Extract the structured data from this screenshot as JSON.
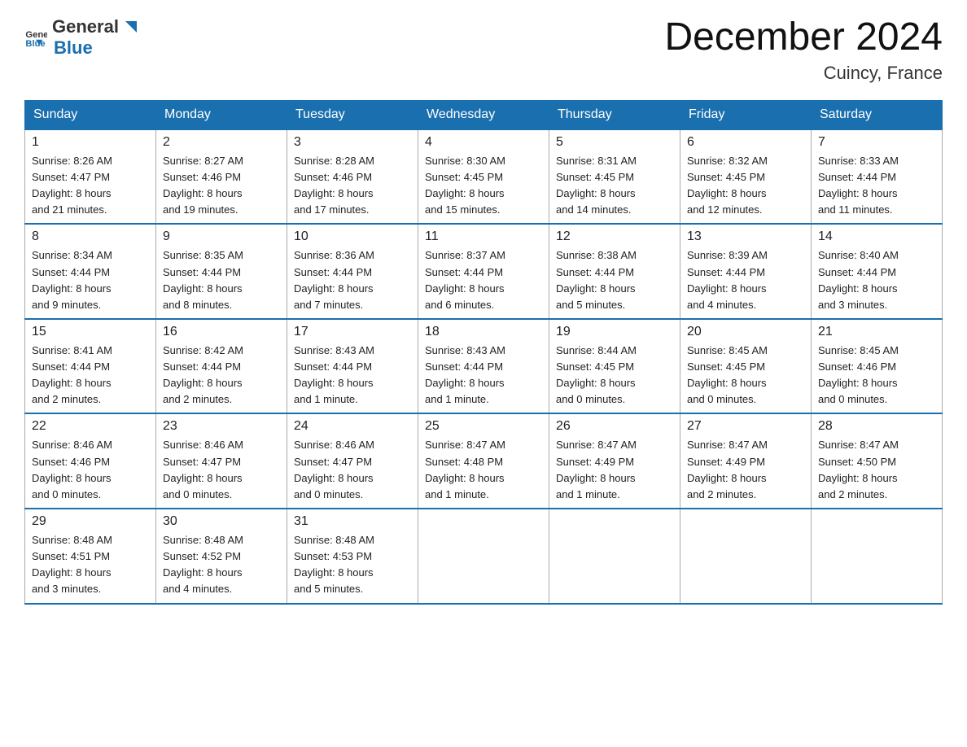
{
  "logo": {
    "general": "General",
    "blue": "Blue"
  },
  "title": "December 2024",
  "location": "Cuincy, France",
  "days_of_week": [
    "Sunday",
    "Monday",
    "Tuesday",
    "Wednesday",
    "Thursday",
    "Friday",
    "Saturday"
  ],
  "weeks": [
    [
      {
        "day": "1",
        "sunrise": "8:26 AM",
        "sunset": "4:47 PM",
        "daylight": "8 hours and 21 minutes."
      },
      {
        "day": "2",
        "sunrise": "8:27 AM",
        "sunset": "4:46 PM",
        "daylight": "8 hours and 19 minutes."
      },
      {
        "day": "3",
        "sunrise": "8:28 AM",
        "sunset": "4:46 PM",
        "daylight": "8 hours and 17 minutes."
      },
      {
        "day": "4",
        "sunrise": "8:30 AM",
        "sunset": "4:45 PM",
        "daylight": "8 hours and 15 minutes."
      },
      {
        "day": "5",
        "sunrise": "8:31 AM",
        "sunset": "4:45 PM",
        "daylight": "8 hours and 14 minutes."
      },
      {
        "day": "6",
        "sunrise": "8:32 AM",
        "sunset": "4:45 PM",
        "daylight": "8 hours and 12 minutes."
      },
      {
        "day": "7",
        "sunrise": "8:33 AM",
        "sunset": "4:44 PM",
        "daylight": "8 hours and 11 minutes."
      }
    ],
    [
      {
        "day": "8",
        "sunrise": "8:34 AM",
        "sunset": "4:44 PM",
        "daylight": "8 hours and 9 minutes."
      },
      {
        "day": "9",
        "sunrise": "8:35 AM",
        "sunset": "4:44 PM",
        "daylight": "8 hours and 8 minutes."
      },
      {
        "day": "10",
        "sunrise": "8:36 AM",
        "sunset": "4:44 PM",
        "daylight": "8 hours and 7 minutes."
      },
      {
        "day": "11",
        "sunrise": "8:37 AM",
        "sunset": "4:44 PM",
        "daylight": "8 hours and 6 minutes."
      },
      {
        "day": "12",
        "sunrise": "8:38 AM",
        "sunset": "4:44 PM",
        "daylight": "8 hours and 5 minutes."
      },
      {
        "day": "13",
        "sunrise": "8:39 AM",
        "sunset": "4:44 PM",
        "daylight": "8 hours and 4 minutes."
      },
      {
        "day": "14",
        "sunrise": "8:40 AM",
        "sunset": "4:44 PM",
        "daylight": "8 hours and 3 minutes."
      }
    ],
    [
      {
        "day": "15",
        "sunrise": "8:41 AM",
        "sunset": "4:44 PM",
        "daylight": "8 hours and 2 minutes."
      },
      {
        "day": "16",
        "sunrise": "8:42 AM",
        "sunset": "4:44 PM",
        "daylight": "8 hours and 2 minutes."
      },
      {
        "day": "17",
        "sunrise": "8:43 AM",
        "sunset": "4:44 PM",
        "daylight": "8 hours and 1 minute."
      },
      {
        "day": "18",
        "sunrise": "8:43 AM",
        "sunset": "4:44 PM",
        "daylight": "8 hours and 1 minute."
      },
      {
        "day": "19",
        "sunrise": "8:44 AM",
        "sunset": "4:45 PM",
        "daylight": "8 hours and 0 minutes."
      },
      {
        "day": "20",
        "sunrise": "8:45 AM",
        "sunset": "4:45 PM",
        "daylight": "8 hours and 0 minutes."
      },
      {
        "day": "21",
        "sunrise": "8:45 AM",
        "sunset": "4:46 PM",
        "daylight": "8 hours and 0 minutes."
      }
    ],
    [
      {
        "day": "22",
        "sunrise": "8:46 AM",
        "sunset": "4:46 PM",
        "daylight": "8 hours and 0 minutes."
      },
      {
        "day": "23",
        "sunrise": "8:46 AM",
        "sunset": "4:47 PM",
        "daylight": "8 hours and 0 minutes."
      },
      {
        "day": "24",
        "sunrise": "8:46 AM",
        "sunset": "4:47 PM",
        "daylight": "8 hours and 0 minutes."
      },
      {
        "day": "25",
        "sunrise": "8:47 AM",
        "sunset": "4:48 PM",
        "daylight": "8 hours and 1 minute."
      },
      {
        "day": "26",
        "sunrise": "8:47 AM",
        "sunset": "4:49 PM",
        "daylight": "8 hours and 1 minute."
      },
      {
        "day": "27",
        "sunrise": "8:47 AM",
        "sunset": "4:49 PM",
        "daylight": "8 hours and 2 minutes."
      },
      {
        "day": "28",
        "sunrise": "8:47 AM",
        "sunset": "4:50 PM",
        "daylight": "8 hours and 2 minutes."
      }
    ],
    [
      {
        "day": "29",
        "sunrise": "8:48 AM",
        "sunset": "4:51 PM",
        "daylight": "8 hours and 3 minutes."
      },
      {
        "day": "30",
        "sunrise": "8:48 AM",
        "sunset": "4:52 PM",
        "daylight": "8 hours and 4 minutes."
      },
      {
        "day": "31",
        "sunrise": "8:48 AM",
        "sunset": "4:53 PM",
        "daylight": "8 hours and 5 minutes."
      },
      null,
      null,
      null,
      null
    ]
  ],
  "labels": {
    "sunrise": "Sunrise:",
    "sunset": "Sunset:",
    "daylight": "Daylight:"
  }
}
